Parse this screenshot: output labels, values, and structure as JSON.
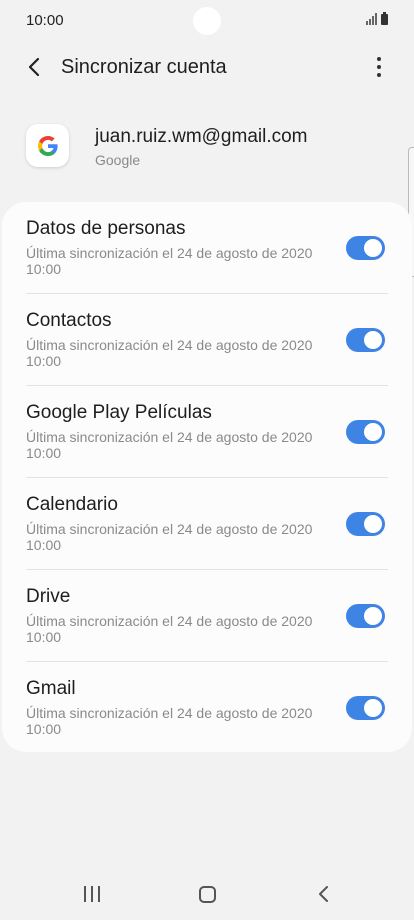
{
  "status_bar": {
    "time": "10:00"
  },
  "app_bar": {
    "title": "Sincronizar cuenta"
  },
  "account": {
    "email": "juan.ruiz.wm@gmail.com",
    "provider": "Google"
  },
  "sync_items": [
    {
      "label": "Datos de personas",
      "subtitle": "Última sincronización el 24 de agosto de 2020 10:00",
      "enabled": true
    },
    {
      "label": "Contactos",
      "subtitle": "Última sincronización el 24 de agosto de 2020 10:00",
      "enabled": true
    },
    {
      "label": "Google Play Películas",
      "subtitle": "Última sincronización el 24 de agosto de 2020 10:00",
      "enabled": true
    },
    {
      "label": "Calendario",
      "subtitle": "Última sincronización el 24 de agosto de 2020 10:00",
      "enabled": true
    },
    {
      "label": "Drive",
      "subtitle": "Última sincronización el 24 de agosto de 2020 10:00",
      "enabled": true
    },
    {
      "label": "Gmail",
      "subtitle": "Última sincronización el 24 de agosto de 2020 10:00",
      "enabled": true
    }
  ],
  "colors": {
    "accent": "#3e84e4",
    "background": "#f2f2f2",
    "card": "#fcfcfc",
    "secondary_text": "#8a8a8a"
  },
  "icons": {
    "back": "back-arrow-icon",
    "more": "more-vert-icon",
    "account": "google-logo-icon",
    "nav_recents": "recents-icon",
    "nav_home": "home-icon",
    "nav_back": "nav-back-icon"
  }
}
